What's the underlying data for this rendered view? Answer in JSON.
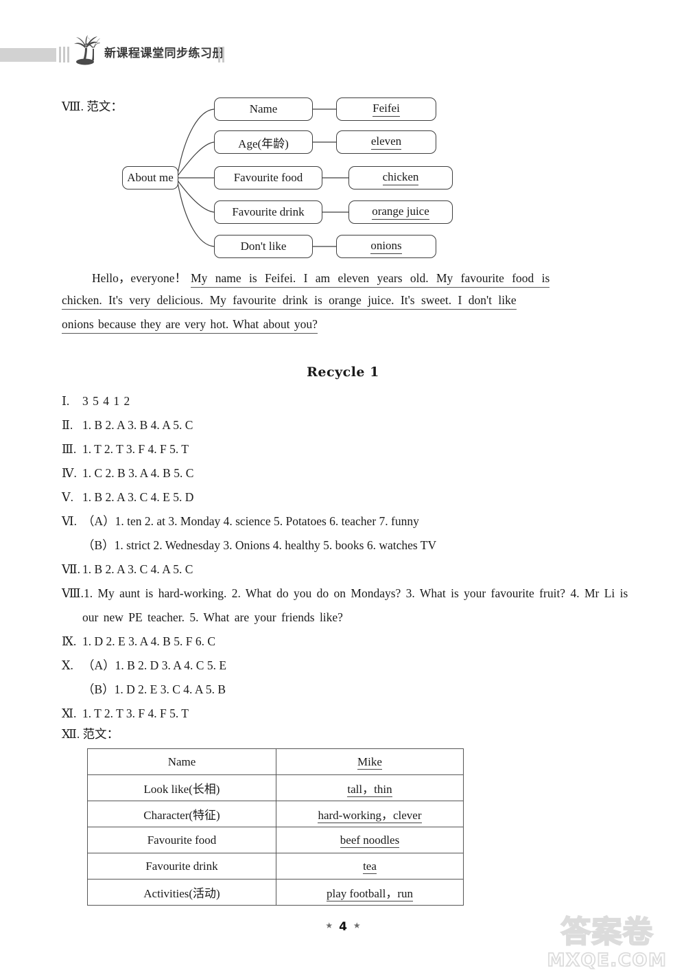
{
  "header": {
    "title": "新课程课堂同步练习册",
    "icon": "palm-tree-icon"
  },
  "mindmap_section": {
    "label": "Ⅷ. 范文：",
    "root": "About me",
    "branches": [
      {
        "key": "Name",
        "value": "Feifei"
      },
      {
        "key": "Age(年龄)",
        "value": "eleven"
      },
      {
        "key": "Favourite food",
        "value": "chicken"
      },
      {
        "key": "Favourite drink",
        "value": "orange juice"
      },
      {
        "key": "Don't like",
        "value": "onions"
      }
    ]
  },
  "essay": {
    "line1_plain": "Hello，everyone！",
    "line1_underlined": "My name is Feifei. I am eleven years old. My favourite food is",
    "line2_underlined": "chicken. It's very delicious. My favourite drink is orange juice. It's sweet. I don't like",
    "line3_underlined": "onions because they are very hot. What about you?"
  },
  "recycle": {
    "title": "Recycle 1",
    "answers": [
      {
        "num": "Ⅰ.",
        "text": "3 5 4 1 2"
      },
      {
        "num": "Ⅱ.",
        "text": "1. B   2. A   3. B   4. A   5. C"
      },
      {
        "num": "Ⅲ.",
        "text": "1. T   2. T   3. F   4. F   5. T"
      },
      {
        "num": "Ⅳ.",
        "text": "1. C   2. B   3. A   4. B   5. C"
      },
      {
        "num": "Ⅴ.",
        "text": "1. B   2. A   3. C   4. E   5. D"
      },
      {
        "num": "Ⅵ.",
        "text": "（A）1. ten   2. at   3. Monday   4. science   5. Potatoes   6. teacher   7. funny"
      },
      {
        "num": "",
        "text": "（B）1. strict   2. Wednesday   3. Onions   4. healthy   5. books   6. watches TV",
        "sub": true
      },
      {
        "num": "Ⅶ.",
        "text": "1. B   2. A   3. C   4. A   5. C"
      },
      {
        "num": "Ⅷ.",
        "text": "1. My aunt is hard-working.   2. What do you do on Mondays?   3. What is your favourite fruit?   4. Mr Li is our new PE teacher.   5. What are your friends like?",
        "wrap": true
      },
      {
        "num": "Ⅸ.",
        "text": "1. D   2. E   3. A   4. B   5. F   6. C"
      },
      {
        "num": "Ⅹ.",
        "text": "（A）1. B   2. D   3. A   4. C   5. E"
      },
      {
        "num": "",
        "text": "（B）1. D   2. E   3. C   4. A   5. B",
        "sub": true
      },
      {
        "num": "Ⅺ.",
        "text": "1. T   2. T   3. F   4. F   5. T"
      }
    ]
  },
  "table_section": {
    "label": "Ⅻ. 范文：",
    "rows": [
      {
        "key": "Name",
        "value": "Mike"
      },
      {
        "key": "Look like(长相)",
        "value": "tall，thin"
      },
      {
        "key": "Character(特征)",
        "value": "hard-working，clever"
      },
      {
        "key": "Favourite food",
        "value": "beef noodles"
      },
      {
        "key": "Favourite drink",
        "value": "tea"
      },
      {
        "key": "Activities(活动)",
        "value": "play football，run"
      }
    ]
  },
  "footer": {
    "star_left": "★",
    "page_number": "4",
    "star_right": "★"
  },
  "watermark": {
    "cn": "答案卷",
    "en": "MXQE.COM"
  },
  "colors": {
    "ink": "#1a1a1a",
    "header_bar": "#d2d2d2",
    "rule": "#555555",
    "watermark": "#dcdcdc"
  }
}
